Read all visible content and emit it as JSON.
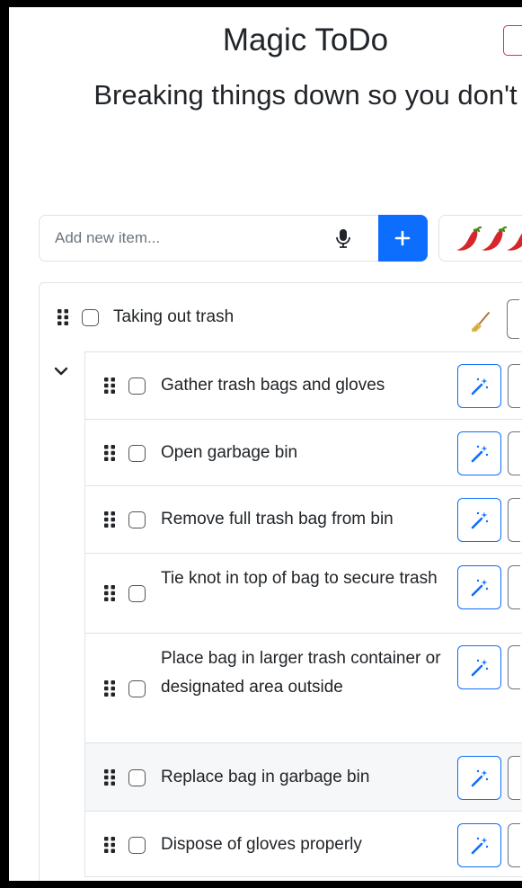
{
  "header": {
    "title": "Magic ToDo",
    "subtitle": "Breaking things down so you don't"
  },
  "new_item": {
    "placeholder": "Add new item...",
    "value": ""
  },
  "spiciness": {
    "level_icons": [
      "chili-pepper",
      "chili-pepper",
      "chili-pepper"
    ]
  },
  "task": {
    "label": "Taking out trash",
    "checked": false,
    "expanded": true,
    "subtasks": [
      {
        "label": "Gather trash bags and gloves",
        "checked": false
      },
      {
        "label": "Open garbage bin",
        "checked": false
      },
      {
        "label": "Remove full trash bag from bin",
        "checked": false
      },
      {
        "label": "Tie knot in top of bag to secure trash",
        "checked": false
      },
      {
        "label": "Place bag in larger trash container or designated area outside",
        "checked": false
      },
      {
        "label": "Replace bag in garbage bin",
        "checked": false
      },
      {
        "label": "Dispose of gloves properly",
        "checked": false
      }
    ]
  },
  "colors": {
    "primary": "#0d6efd",
    "danger": "#dc3545",
    "border": "#dee2e6",
    "chili": "#d6262a"
  }
}
